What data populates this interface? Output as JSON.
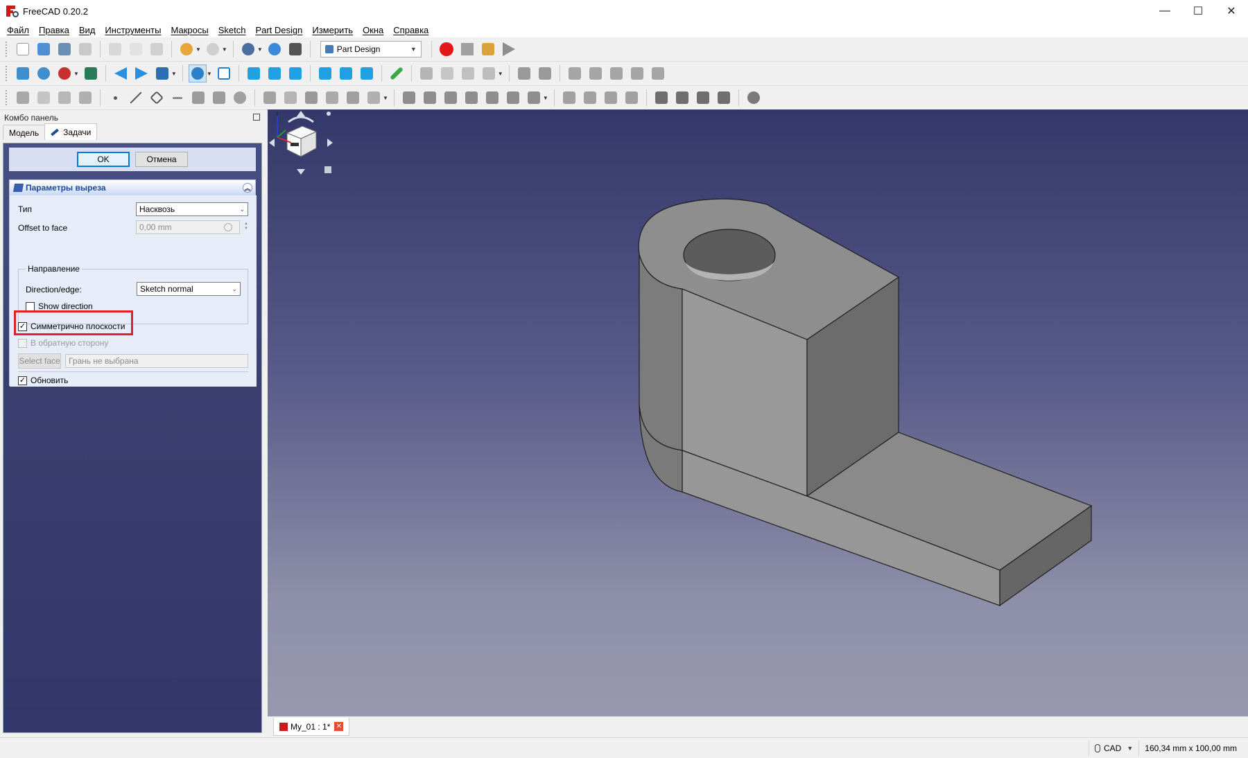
{
  "window": {
    "title": "FreeCAD 0.20.2",
    "minimize": "—",
    "maximize": "☐",
    "close": "✕"
  },
  "menu": [
    "Файл",
    "Правка",
    "Вид",
    "Инструменты",
    "Макросы",
    "Sketch",
    "Part Design",
    "Измерить",
    "Окна",
    "Справка"
  ],
  "toolbar": {
    "workbench": "Part Design"
  },
  "combo": {
    "title": "Комбо панель",
    "tabs": {
      "model": "Модель",
      "tasks": "Задачи"
    },
    "ok": "OK",
    "cancel": "Отмена",
    "params_title": "Параметры выреза",
    "type_label": "Тип",
    "type_value": "Насквозь",
    "offset_label": "Offset to face",
    "offset_value": "0,00 mm",
    "direction_group": "Направление",
    "direction_label": "Direction/edge:",
    "direction_value": "Sketch normal",
    "show_direction": "Show direction",
    "symmetric": "Симметрично плоскости",
    "reversed": "В обратную сторону",
    "select_face": "Select face",
    "face_placeholder": "Грань не выбрана",
    "update": "Обновить"
  },
  "doc_tab": {
    "label": "My_01 : 1*"
  },
  "status": {
    "nav_style": "CAD",
    "dimensions": "160,34 mm x 100,00 mm"
  },
  "colors": {
    "accent_red": "#e0212a",
    "viewport_top": "#33386a",
    "viewport_bottom": "#9899b0"
  }
}
